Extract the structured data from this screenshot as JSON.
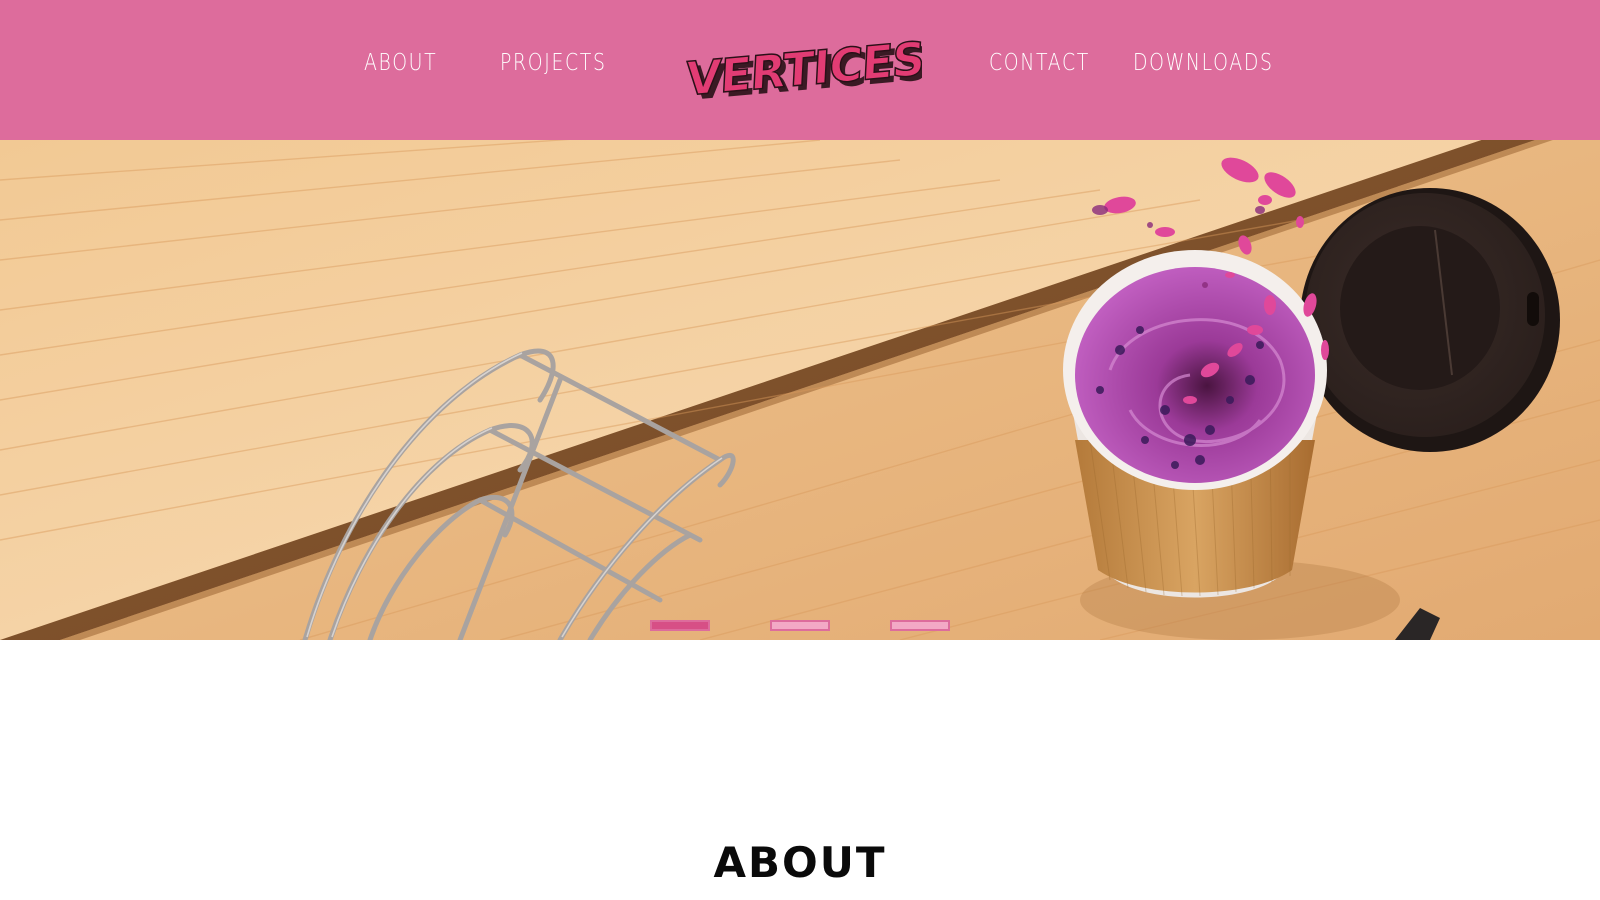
{
  "nav": {
    "about": "ABOUT",
    "projects": "PROJECTS",
    "contact": "CONTACT",
    "downloads": "DOWNLOADS"
  },
  "logo": {
    "text": "VERTICES"
  },
  "hero": {
    "slide_indicators": [
      {
        "active": true
      },
      {
        "active": false
      },
      {
        "active": false
      }
    ]
  },
  "about_section": {
    "title": "ABOUT"
  },
  "colors": {
    "header_bg": "#dd6c9c",
    "logo_fill": "#e23c74",
    "logo_shadow": "#3a1a24",
    "indicator_active": "#d74f86",
    "indicator_inactive": "#f3a9c6"
  },
  "icons": {
    "hero_image": "coffee-cup-splash-illustration"
  }
}
